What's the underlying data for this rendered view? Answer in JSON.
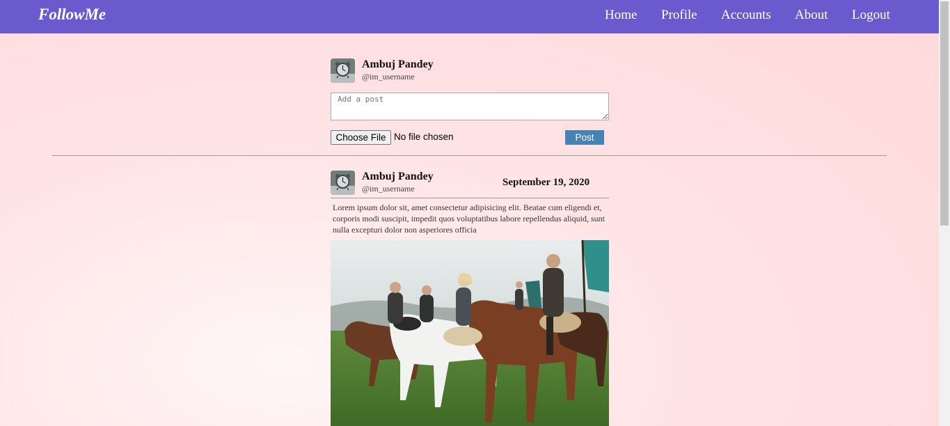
{
  "navbar": {
    "brand": "FollowMe",
    "links": [
      "Home",
      "Profile",
      "Accounts",
      "About",
      "Logout"
    ]
  },
  "composer": {
    "user_name": "Ambuj Pandey",
    "user_handle": "@im_username",
    "placeholder": "Add a post",
    "file_button": "Choose File",
    "file_status": "No file chosen",
    "post_button": "Post"
  },
  "post": {
    "user_name": "Ambuj Pandey",
    "user_handle": "@im_username",
    "date": "September 19, 2020",
    "text": "Lorem ipsum dolor sit, amet consectetur adipisicing elit. Beatae cum eligendi et, corporis modi suscipit, impedit quos voluptatibus labore repellendus aliquid, sunt nulla excepturi dolor non asperiores officia"
  },
  "colors": {
    "navbar": "#6a5acd",
    "post_button": "#4682b4",
    "background": "#ffe0e2"
  }
}
